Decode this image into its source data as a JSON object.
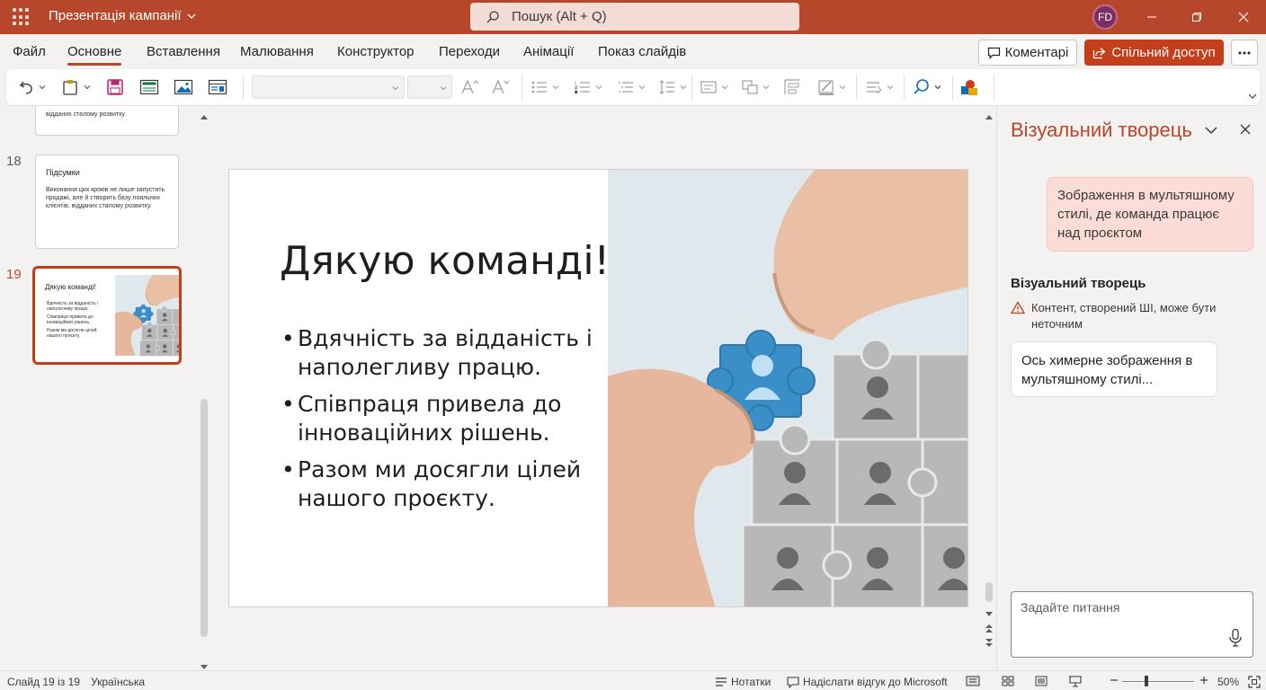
{
  "app": {
    "title": "Презентація кампанії",
    "user_initials": "FD",
    "accent_color": "#b7472a",
    "search_placeholder": "Пошук (Alt + Q)"
  },
  "menu": {
    "tabs": [
      "Файл",
      "Основне",
      "Вставлення",
      "Малювання",
      "Конструктор",
      "Переходи",
      "Анімації",
      "Показ слайдів"
    ],
    "active_tab": "Основне",
    "comments_label": "Коментарі",
    "share_label": "Спільний доступ"
  },
  "ribbon": {
    "icons": [
      "undo-icon",
      "paste-icon",
      "save-icon",
      "layout-icon",
      "picture-icon",
      "design-icon",
      "font-grow-icon",
      "font-shrink-icon",
      "bullets-icon",
      "numbering-icon",
      "multilevel-icon",
      "line-spacing-icon",
      "shapes-icon",
      "arrange-icon",
      "fill-icon",
      "outline-icon",
      "align-icon",
      "find-icon",
      "designer-icon"
    ]
  },
  "thumbnails": [
    {
      "number": "",
      "title": "",
      "body": "відданих сталому розвитку."
    },
    {
      "number": "18",
      "title": "Підсумки",
      "body": "Виконання цих кроків не лише запустить продажі, але й створить базу лояльних клієнтів, відданих сталому розвитку."
    },
    {
      "number": "19",
      "title": "Дякую команді!",
      "body_items": [
        "Вдячність за відданість і наполегливу працю.",
        "Співпраця привела до інноваційних рішень.",
        "Разом ми досягли цілей нашого проєкту."
      ]
    }
  ],
  "slide": {
    "title": "Дякую команді!",
    "bullets": [
      "Вдячність за відданість і наполегливу працю.",
      "Співпраця привела до інноваційних рішень.",
      "Разом ми досягли цілей нашого проєкту."
    ]
  },
  "pane": {
    "title": "Візуальний творець",
    "user_prompt": "Зображення в мультяшному стилі, де команда працює над проєктом",
    "response_title": "Візуальний творець",
    "warning": "Контент, створений ШІ, може бути неточним",
    "response": "Ось химерне зображення в мультяшному стилі...",
    "ask_placeholder": "Задайте питання"
  },
  "status": {
    "slide_info": "Слайд 19 із 19",
    "language": "Українська",
    "notes": "Нотатки",
    "feedback": "Надіслати відгук до Microsoft",
    "zoom": "50%"
  }
}
